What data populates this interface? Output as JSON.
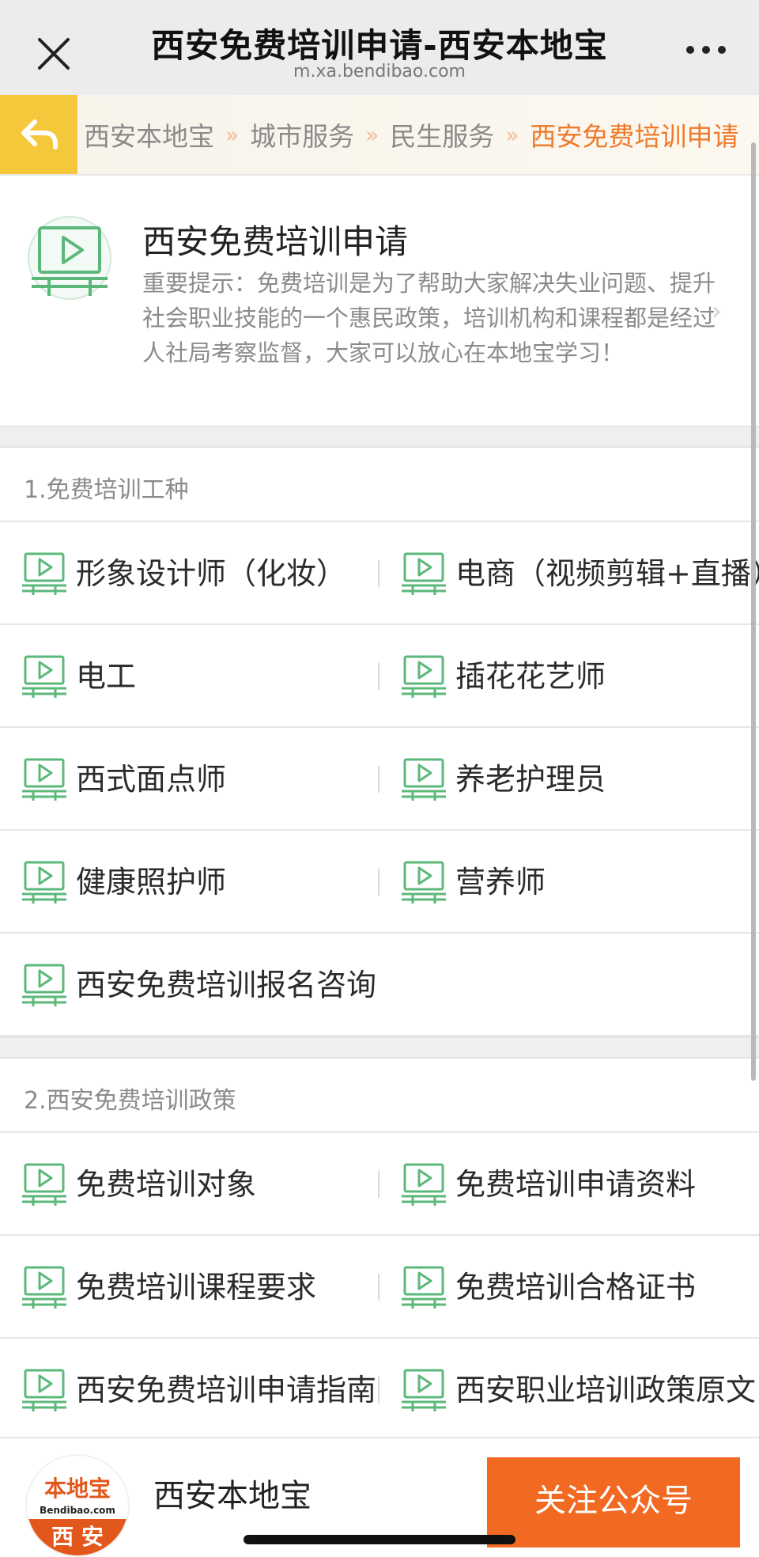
{
  "window": {
    "title": "西安免费培训申请-西安本地宝",
    "url": "m.xa.bendibao.com"
  },
  "breadcrumb": {
    "items": [
      "西安本地宝",
      "城市服务",
      "民生服务",
      "西安免费培训申请"
    ],
    "separator": "»"
  },
  "intro": {
    "title": "西安免费培训申请",
    "text": "重要提示：免费培训是为了帮助大家解决失业问题、提升社会职业技能的一个惠民政策，培训机构和课程都是经过人社局考察监督，大家可以放心在本地宝学习！",
    "arrow": "›"
  },
  "section1": {
    "heading": "1.免费培训工种",
    "items": [
      "形象设计师（化妆）",
      "电商（视频剪辑+直播）",
      "电工",
      "插花花艺师",
      "西式面点师",
      "养老护理员",
      "健康照护师",
      "营养师",
      "西安免费培训报名咨询"
    ]
  },
  "section2": {
    "heading": "2.西安免费培训政策",
    "items": [
      "免费培训对象",
      "免费培训申请资料",
      "免费培训课程要求",
      "免费培训合格证书",
      "西安免费培训申请指南",
      "西安职业培训政策原文"
    ]
  },
  "footer": {
    "logo_top": "本地宝",
    "logo_mid": "Bendibao.com",
    "logo_bottom": "西 安",
    "name": "西安本地宝",
    "follow_label": "关注公众号"
  },
  "colors": {
    "accent_orange": "#ee7a2a",
    "back_yellow": "#f5c83b",
    "icon_green": "#5cb87a",
    "follow_button": "#f26a22"
  },
  "icons": {
    "close": "close-icon",
    "more": "more-dots-icon",
    "back": "back-arrow-icon",
    "item": "video-course-icon"
  }
}
